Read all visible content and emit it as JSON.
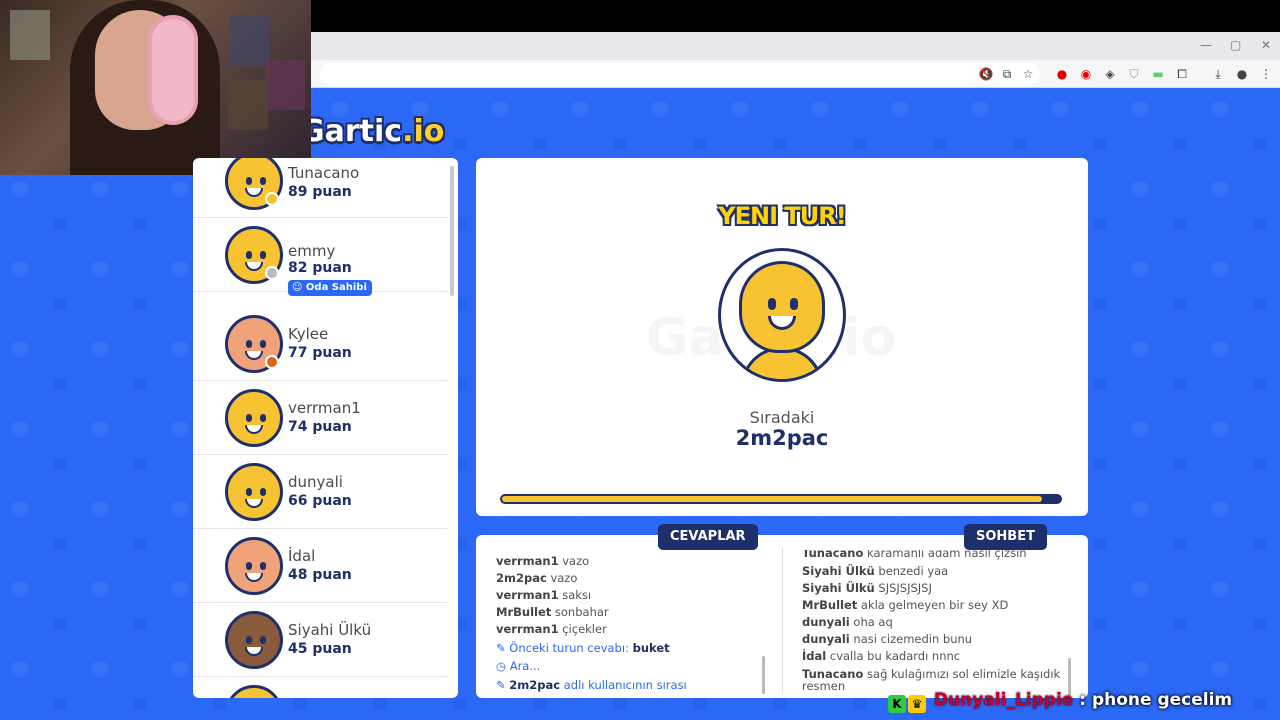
{
  "browser": {
    "window_min": "—",
    "window_max": "▢",
    "window_close": "✕",
    "toolbar_icons": [
      "mute-icon",
      "cast-icon",
      "star-icon",
      "opera-icon",
      "record-icon",
      "extension-icon",
      "shield-icon",
      "extension-green-icon",
      "puzzle-icon",
      "download-icon",
      "profile-icon",
      "menu-icon"
    ]
  },
  "game": {
    "logo_main": "Gartic",
    "logo_accent": ".io"
  },
  "players": [
    {
      "name": "Tunacano",
      "score": "89 puan",
      "status_color": "#f7c332",
      "avatar": "default"
    },
    {
      "name": "emmy",
      "score": "82 puan",
      "status_color": "#bbbbbb",
      "avatar": "default",
      "badge": "Oda Sahibi"
    },
    {
      "name": "Kylee",
      "score": "77 puan",
      "status_color": "#d9641a",
      "avatar": "hat"
    },
    {
      "name": "verrman1",
      "score": "74 puan",
      "avatar": "default"
    },
    {
      "name": "dunyali",
      "score": "66 puan",
      "avatar": "default"
    },
    {
      "name": "İdal",
      "score": "48 puan",
      "avatar": "glasses"
    },
    {
      "name": "Siyahi Ülkü",
      "score": "45 puan",
      "avatar": "dark"
    }
  ],
  "round": {
    "title": "YENI TUR!",
    "next_label": "Sıradaki",
    "next_player": "2m2pac",
    "watermark": "Gartic.io",
    "progress_fraction": 0.96
  },
  "tabs": {
    "answers": "CEVAPLAR",
    "chat": "SOHBET"
  },
  "answers": [
    {
      "user": "verrman1",
      "text": "vazo"
    },
    {
      "user": "2m2pac",
      "text": "vazo"
    },
    {
      "user": "verrman1",
      "text": "saksı"
    },
    {
      "user": "MrBullet",
      "text": "sonbahar"
    },
    {
      "user": "verrman1",
      "text": "çiçekler"
    }
  ],
  "system_msgs": [
    {
      "icon": "pencil-icon",
      "text": "Önceki turun cevabı:",
      "bold": "buket"
    },
    {
      "icon": "clock-icon",
      "text": "Ara...",
      "bold": ""
    },
    {
      "icon": "pencil-icon",
      "bold": "2m2pac",
      "text": "adlı kullanıcının sırası"
    }
  ],
  "chat": [
    {
      "user": "Tunacano",
      "text": "karamanlı adam nasıl çizsin"
    },
    {
      "user": "Siyahi Ülkü",
      "text": "benzedi yaa"
    },
    {
      "user": "Siyahi Ülkü",
      "text": "SJSJSJSJSJ"
    },
    {
      "user": "MrBullet",
      "text": "akla gelmeyen bir sey XD"
    },
    {
      "user": "dunyali",
      "text": "oha aq"
    },
    {
      "user": "dunyali",
      "text": "nasi cizemedin bunu"
    },
    {
      "user": "İdal",
      "text": "cvalla bu kadardı nnnc"
    },
    {
      "user": "Tunacano",
      "text": "sağ kulağımızı sol elimizle kaşıdık"
    },
    {
      "user": "",
      "text": "resmen"
    }
  ],
  "stream_overlay": {
    "user": "Dunyali_Lippie",
    "separator": ":",
    "message": "phone gecelim",
    "badge1_color": "#2ecc40",
    "badge2_color": "#ffcc00"
  }
}
